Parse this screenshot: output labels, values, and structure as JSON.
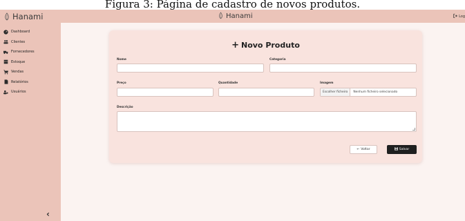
{
  "caption": "Figura 3: Página de cadastro de novos produtos.",
  "brand": {
    "name": "Hanami"
  },
  "topbar": {
    "brand": "Hanami",
    "logout_label": "Log"
  },
  "sidebar": {
    "items": [
      {
        "label": "Dashboard",
        "icon": "gauge-icon"
      },
      {
        "label": "Clientes",
        "icon": "users-icon"
      },
      {
        "label": "Fornecedores",
        "icon": "truck-icon"
      },
      {
        "label": "Estoque",
        "icon": "box-icon"
      },
      {
        "label": "Vendas",
        "icon": "cart-icon"
      },
      {
        "label": "Relatórios",
        "icon": "file-icon"
      },
      {
        "label": "Usuários",
        "icon": "user-cog-icon"
      }
    ],
    "collapse_glyph": "‹"
  },
  "form": {
    "title": "Novo Produto",
    "title_icon": "plus-icon",
    "fields": {
      "nome": {
        "label": "Nome",
        "value": ""
      },
      "categoria": {
        "label": "Categoria",
        "value": ""
      },
      "preco": {
        "label": "Preço",
        "value": ""
      },
      "quantidade": {
        "label": "Quantidade",
        "value": ""
      },
      "imagem": {
        "label": "Imagem",
        "button": "Escolher ficheiro",
        "status": "Nenhum ficheiro selecionado"
      },
      "descricao": {
        "label": "Descrição",
        "value": ""
      }
    },
    "back_label": "Voltar",
    "save_label": "Salvar"
  },
  "colors": {
    "sidebar_bg": "#ebc4b9",
    "card_bg": "#f9e3de",
    "main_bg": "#fbf3f1",
    "save_bg": "#1f1f1f"
  }
}
